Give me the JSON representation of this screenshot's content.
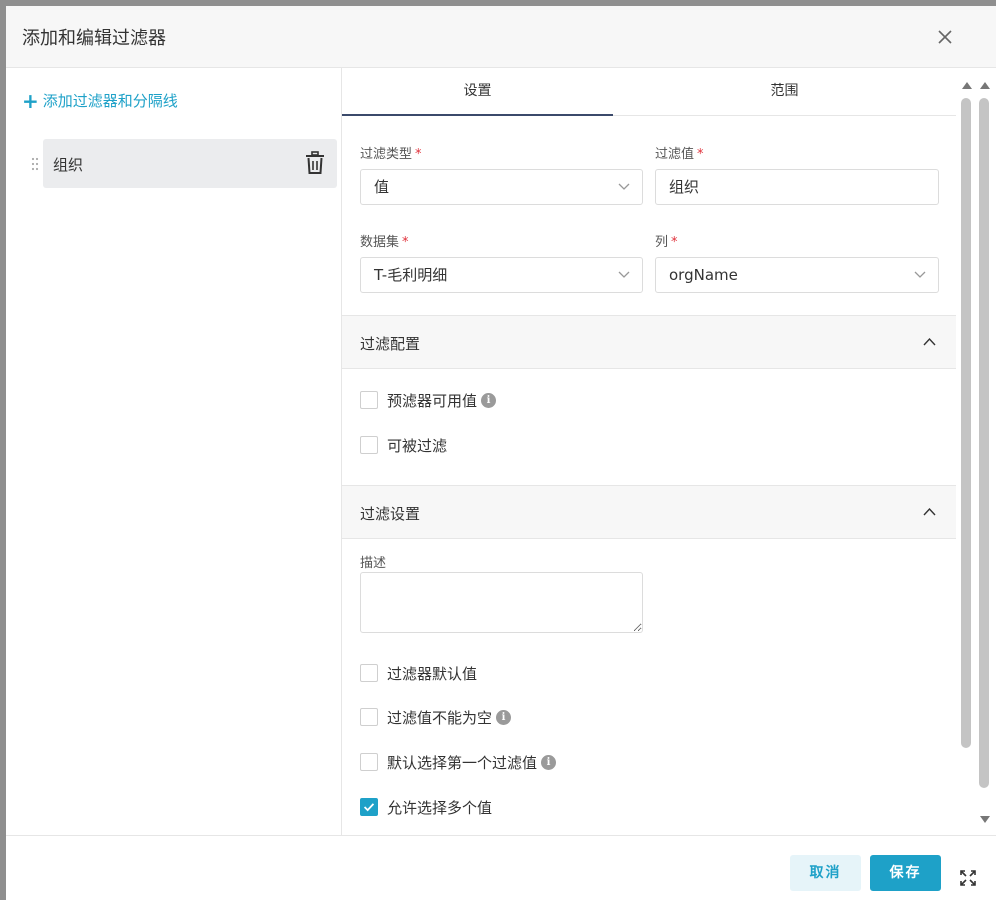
{
  "dialog": {
    "title": "添加和编辑过滤器",
    "close_icon": "close-icon"
  },
  "left": {
    "add_label": "添加过滤器和分隔线",
    "items": [
      {
        "label": "组织"
      }
    ]
  },
  "tabs": [
    {
      "label": "设置",
      "active": true
    },
    {
      "label": "范围",
      "active": false
    }
  ],
  "form": {
    "filter_type": {
      "label": "过滤类型",
      "value": "值"
    },
    "filter_value": {
      "label": "过滤值",
      "value": "组织"
    },
    "dataset": {
      "label": "数据集",
      "value": "T-毛利明细"
    },
    "column": {
      "label": "列",
      "value": "orgName"
    },
    "required_mark": "*"
  },
  "sections": {
    "config": {
      "title": "过滤配置",
      "options": [
        {
          "label": "预滤器可用值",
          "checked": false,
          "info": true
        },
        {
          "label": "可被过滤",
          "checked": false,
          "info": false
        }
      ]
    },
    "settings": {
      "title": "过滤设置",
      "desc_label": "描述",
      "options": [
        {
          "label": "过滤器默认值",
          "checked": false,
          "info": false
        },
        {
          "label": "过滤值不能为空",
          "checked": false,
          "info": true
        },
        {
          "label": "默认选择第一个过滤值",
          "checked": false,
          "info": true
        },
        {
          "label": "允许选择多个值",
          "checked": true,
          "info": false
        }
      ]
    }
  },
  "footer": {
    "cancel_label": "取消",
    "save_label": "保存"
  },
  "info_glyph": "i",
  "colors": {
    "accent": "#1ea1c8",
    "required": "#e0303a",
    "tab_underline": "#3b4a6b"
  }
}
